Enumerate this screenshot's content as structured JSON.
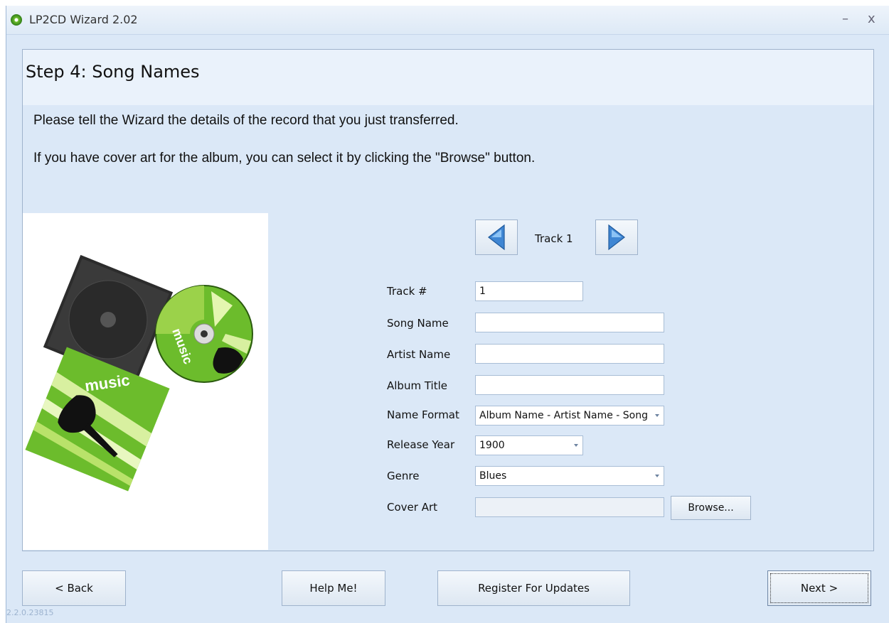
{
  "window": {
    "title": "LP2CD Wizard 2.02",
    "minimize_glyph": "–",
    "close_glyph": "x"
  },
  "step": {
    "title": "Step 4: Song Names"
  },
  "instructions": [
    "Please tell the Wizard the details of the record that you just transferred.",
    "If you have cover art for the album, you can select it by clicking the \"Browse\" button."
  ],
  "artwork": {
    "disc_text": "music",
    "booklet_text": "music"
  },
  "track_nav": {
    "label": "Track 1",
    "prev_icon": "arrow-left-icon",
    "next_icon": "arrow-right-icon"
  },
  "form": {
    "track_number": {
      "label": "Track #",
      "value": "1"
    },
    "song_name": {
      "label": "Song Name",
      "value": ""
    },
    "artist_name": {
      "label": "Artist Name",
      "value": ""
    },
    "album_title": {
      "label": "Album Title",
      "value": ""
    },
    "name_format": {
      "label": "Name Format",
      "value": "Album Name - Artist Name - Song"
    },
    "release_year": {
      "label": "Release Year",
      "value": "1900"
    },
    "genre": {
      "label": "Genre",
      "value": "Blues"
    },
    "cover_art": {
      "label": "Cover Art",
      "value": "",
      "browse_label": "Browse..."
    }
  },
  "buttons": {
    "back": "< Back",
    "help": "Help Me!",
    "register": "Register For Updates",
    "next": "Next >"
  },
  "version": "2.2.0.23815",
  "colors": {
    "window_bg": "#dbe8f7",
    "header_bg": "#eaf2fb",
    "border": "#9fb3cc",
    "accent_green": "#6cbc2c"
  }
}
